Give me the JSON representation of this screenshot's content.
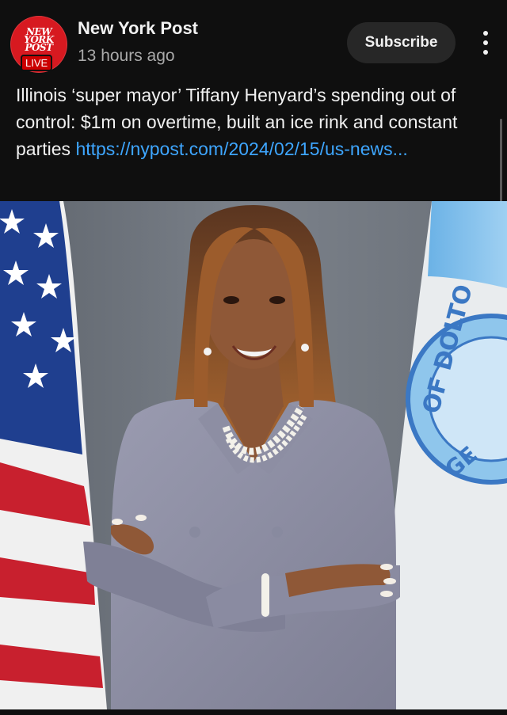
{
  "channel": {
    "name": "New York Post",
    "avatar_logo": "NEW YORK POST",
    "live_badge": "LIVE",
    "time": "13 hours ago"
  },
  "actions": {
    "subscribe_label": "Subscribe",
    "more_icon": "more-vertical-icon"
  },
  "post": {
    "text": "Illinois ‘super mayor’ Tiffany Henyard’s spending out of control: $1m on overtime, built an ice rink and constant parties ",
    "link": "https://nypost.com/2024/02/15/us-news..."
  },
  "image": {
    "seal_text": "OF DOLTO",
    "seal_text_lower": "GE"
  },
  "colors": {
    "background": "#0f0f0f",
    "link": "#3ea6ff",
    "brand_red": "#d71920",
    "button_bg": "#272727"
  }
}
